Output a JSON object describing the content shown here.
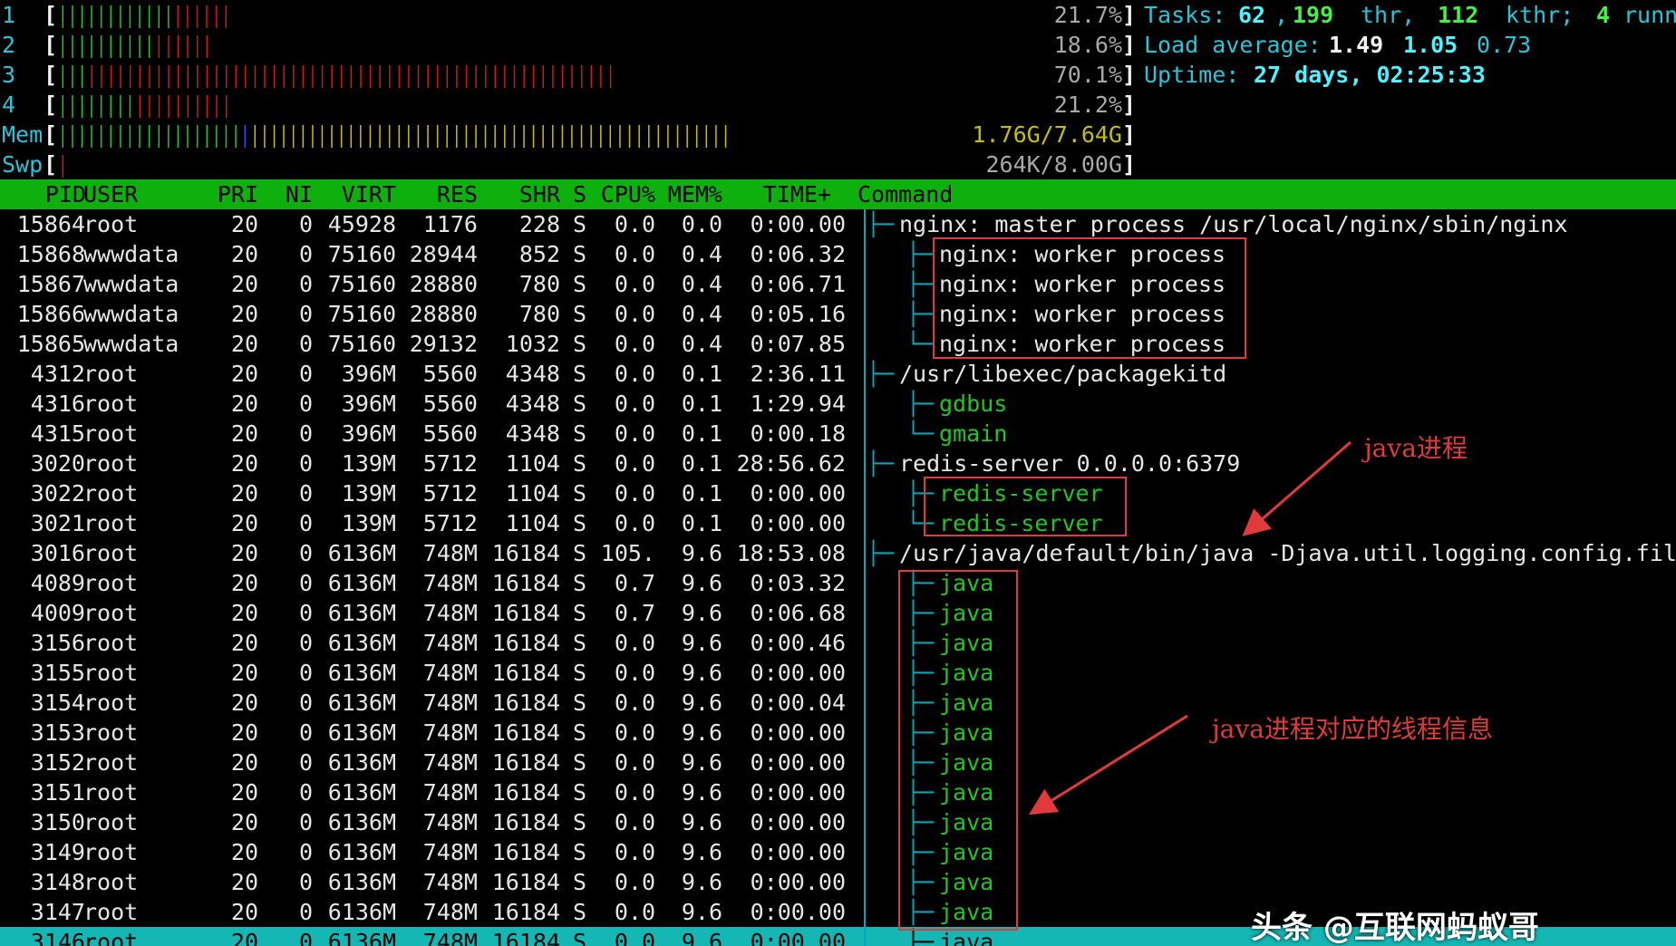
{
  "meters": {
    "cpus": [
      {
        "label": "1",
        "green_bars": 12,
        "red_bars": 6,
        "percent": "21.7%"
      },
      {
        "label": "2",
        "green_bars": 10,
        "red_bars": 6,
        "percent": "18.6%"
      },
      {
        "label": "3",
        "green_bars": 3,
        "red_bars": 55,
        "percent": "70.1%"
      },
      {
        "label": "4",
        "green_bars": 8,
        "red_bars": 10,
        "percent": "21.2%"
      }
    ],
    "mem": {
      "label": "Mem",
      "green_bars": 19,
      "blue_bars": 1,
      "yellow_bars": 50,
      "value": "1.76G/7.64G"
    },
    "swp": {
      "label": "Swp",
      "red_bars": 1,
      "value": "264K/8.00G"
    },
    "open_bracket": "[",
    "close_bracket": "]"
  },
  "summary": {
    "tasks_label": "Tasks:",
    "tasks": "62",
    "thr": "199",
    "thr_label": "thr,",
    "kthr": "112",
    "kthr_label": "kthr;",
    "running": "4",
    "running_label": "running",
    "comma": ",",
    "load_label": "Load average:",
    "load1": "1.49",
    "load5": "1.05",
    "load15": "0.73",
    "uptime_label": "Uptime:",
    "uptime": "27 days, 02:25:33"
  },
  "columns": [
    "PID",
    "USER",
    "PRI",
    "NI",
    "VIRT",
    "RES",
    "SHR",
    "S",
    "CPU%",
    "MEM%",
    "TIME+",
    "Command"
  ],
  "processes": [
    {
      "pid": "15864",
      "user": "root",
      "pri": "20",
      "ni": "0",
      "virt": "45928",
      "res": "1176",
      "shr": "228",
      "s": "S",
      "cpu": "0.0",
      "mem": "0.0",
      "time": "0:00.00",
      "tree": "├─",
      "indent": 0,
      "cmd": "nginx: master process /usr/local/nginx/sbin/nginx",
      "thread": false
    },
    {
      "pid": "15868",
      "user": "wwwdata",
      "pri": "20",
      "ni": "0",
      "virt": "75160",
      "res": "28944",
      "shr": "852",
      "s": "S",
      "cpu": "0.0",
      "mem": "0.4",
      "time": "0:06.32",
      "tree": "├─",
      "indent": 1,
      "cmd": "nginx: worker process",
      "thread": false
    },
    {
      "pid": "15867",
      "user": "wwwdata",
      "pri": "20",
      "ni": "0",
      "virt": "75160",
      "res": "28880",
      "shr": "780",
      "s": "S",
      "cpu": "0.0",
      "mem": "0.4",
      "time": "0:06.71",
      "tree": "├─",
      "indent": 1,
      "cmd": "nginx: worker process",
      "thread": false
    },
    {
      "pid": "15866",
      "user": "wwwdata",
      "pri": "20",
      "ni": "0",
      "virt": "75160",
      "res": "28880",
      "shr": "780",
      "s": "S",
      "cpu": "0.0",
      "mem": "0.4",
      "time": "0:05.16",
      "tree": "├─",
      "indent": 1,
      "cmd": "nginx: worker process",
      "thread": false
    },
    {
      "pid": "15865",
      "user": "wwwdata",
      "pri": "20",
      "ni": "0",
      "virt": "75160",
      "res": "29132",
      "shr": "1032",
      "s": "S",
      "cpu": "0.0",
      "mem": "0.4",
      "time": "0:07.85",
      "tree": "└─",
      "indent": 1,
      "cmd": "nginx: worker process",
      "thread": false
    },
    {
      "pid": "4312",
      "user": "root",
      "pri": "20",
      "ni": "0",
      "virt": "396M",
      "res": "5560",
      "shr": "4348",
      "s": "S",
      "cpu": "0.0",
      "mem": "0.1",
      "time": "2:36.11",
      "tree": "├─",
      "indent": 0,
      "cmd": "/usr/libexec/packagekitd",
      "thread": false
    },
    {
      "pid": "4316",
      "user": "root",
      "pri": "20",
      "ni": "0",
      "virt": "396M",
      "res": "5560",
      "shr": "4348",
      "s": "S",
      "cpu": "0.0",
      "mem": "0.1",
      "time": "1:29.94",
      "tree": "├─",
      "indent": 1,
      "cmd": "gdbus",
      "thread": true
    },
    {
      "pid": "4315",
      "user": "root",
      "pri": "20",
      "ni": "0",
      "virt": "396M",
      "res": "5560",
      "shr": "4348",
      "s": "S",
      "cpu": "0.0",
      "mem": "0.1",
      "time": "0:00.18",
      "tree": "└─",
      "indent": 1,
      "cmd": "gmain",
      "thread": true
    },
    {
      "pid": "3020",
      "user": "root",
      "pri": "20",
      "ni": "0",
      "virt": "139M",
      "res": "5712",
      "shr": "1104",
      "s": "S",
      "cpu": "0.0",
      "mem": "0.1",
      "time": "28:56.62",
      "tree": "├─",
      "indent": 0,
      "cmd": "redis-server 0.0.0.0:6379",
      "thread": false
    },
    {
      "pid": "3022",
      "user": "root",
      "pri": "20",
      "ni": "0",
      "virt": "139M",
      "res": "5712",
      "shr": "1104",
      "s": "S",
      "cpu": "0.0",
      "mem": "0.1",
      "time": "0:00.00",
      "tree": "├─",
      "indent": 1,
      "cmd": "redis-server",
      "thread": true
    },
    {
      "pid": "3021",
      "user": "root",
      "pri": "20",
      "ni": "0",
      "virt": "139M",
      "res": "5712",
      "shr": "1104",
      "s": "S",
      "cpu": "0.0",
      "mem": "0.1",
      "time": "0:00.00",
      "tree": "└─",
      "indent": 1,
      "cmd": "redis-server",
      "thread": true
    },
    {
      "pid": "3016",
      "user": "root",
      "pri": "20",
      "ni": "0",
      "virt": "6136M",
      "res": "748M",
      "shr": "16184",
      "s": "S",
      "cpu": "105.",
      "mem": "9.6",
      "time": "18:53.08",
      "tree": "├─",
      "indent": 0,
      "cmd": "/usr/java/default/bin/java -Djava.util.logging.config.fil",
      "thread": false
    },
    {
      "pid": "4089",
      "user": "root",
      "pri": "20",
      "ni": "0",
      "virt": "6136M",
      "res": "748M",
      "shr": "16184",
      "s": "S",
      "cpu": "0.7",
      "mem": "9.6",
      "time": "0:03.32",
      "tree": "├─",
      "indent": 1,
      "cmd": "java",
      "thread": true
    },
    {
      "pid": "4009",
      "user": "root",
      "pri": "20",
      "ni": "0",
      "virt": "6136M",
      "res": "748M",
      "shr": "16184",
      "s": "S",
      "cpu": "0.7",
      "mem": "9.6",
      "time": "0:06.68",
      "tree": "├─",
      "indent": 1,
      "cmd": "java",
      "thread": true
    },
    {
      "pid": "3156",
      "user": "root",
      "pri": "20",
      "ni": "0",
      "virt": "6136M",
      "res": "748M",
      "shr": "16184",
      "s": "S",
      "cpu": "0.0",
      "mem": "9.6",
      "time": "0:00.46",
      "tree": "├─",
      "indent": 1,
      "cmd": "java",
      "thread": true
    },
    {
      "pid": "3155",
      "user": "root",
      "pri": "20",
      "ni": "0",
      "virt": "6136M",
      "res": "748M",
      "shr": "16184",
      "s": "S",
      "cpu": "0.0",
      "mem": "9.6",
      "time": "0:00.00",
      "tree": "├─",
      "indent": 1,
      "cmd": "java",
      "thread": true
    },
    {
      "pid": "3154",
      "user": "root",
      "pri": "20",
      "ni": "0",
      "virt": "6136M",
      "res": "748M",
      "shr": "16184",
      "s": "S",
      "cpu": "0.0",
      "mem": "9.6",
      "time": "0:00.04",
      "tree": "├─",
      "indent": 1,
      "cmd": "java",
      "thread": true
    },
    {
      "pid": "3153",
      "user": "root",
      "pri": "20",
      "ni": "0",
      "virt": "6136M",
      "res": "748M",
      "shr": "16184",
      "s": "S",
      "cpu": "0.0",
      "mem": "9.6",
      "time": "0:00.00",
      "tree": "├─",
      "indent": 1,
      "cmd": "java",
      "thread": true
    },
    {
      "pid": "3152",
      "user": "root",
      "pri": "20",
      "ni": "0",
      "virt": "6136M",
      "res": "748M",
      "shr": "16184",
      "s": "S",
      "cpu": "0.0",
      "mem": "9.6",
      "time": "0:00.00",
      "tree": "├─",
      "indent": 1,
      "cmd": "java",
      "thread": true
    },
    {
      "pid": "3151",
      "user": "root",
      "pri": "20",
      "ni": "0",
      "virt": "6136M",
      "res": "748M",
      "shr": "16184",
      "s": "S",
      "cpu": "0.0",
      "mem": "9.6",
      "time": "0:00.00",
      "tree": "├─",
      "indent": 1,
      "cmd": "java",
      "thread": true
    },
    {
      "pid": "3150",
      "user": "root",
      "pri": "20",
      "ni": "0",
      "virt": "6136M",
      "res": "748M",
      "shr": "16184",
      "s": "S",
      "cpu": "0.0",
      "mem": "9.6",
      "time": "0:00.00",
      "tree": "├─",
      "indent": 1,
      "cmd": "java",
      "thread": true
    },
    {
      "pid": "3149",
      "user": "root",
      "pri": "20",
      "ni": "0",
      "virt": "6136M",
      "res": "748M",
      "shr": "16184",
      "s": "S",
      "cpu": "0.0",
      "mem": "9.6",
      "time": "0:00.00",
      "tree": "├─",
      "indent": 1,
      "cmd": "java",
      "thread": true
    },
    {
      "pid": "3148",
      "user": "root",
      "pri": "20",
      "ni": "0",
      "virt": "6136M",
      "res": "748M",
      "shr": "16184",
      "s": "S",
      "cpu": "0.0",
      "mem": "9.6",
      "time": "0:00.00",
      "tree": "├─",
      "indent": 1,
      "cmd": "java",
      "thread": true
    },
    {
      "pid": "3147",
      "user": "root",
      "pri": "20",
      "ni": "0",
      "virt": "6136M",
      "res": "748M",
      "shr": "16184",
      "s": "S",
      "cpu": "0.0",
      "mem": "9.6",
      "time": "0:00.00",
      "tree": "├─",
      "indent": 1,
      "cmd": "java",
      "thread": true
    },
    {
      "pid": "3146",
      "user": "root",
      "pri": "20",
      "ni": "0",
      "virt": "6136M",
      "res": "748M",
      "shr": "16184",
      "s": "S",
      "cpu": "0.0",
      "mem": "9.6",
      "time": "0:00.00",
      "tree": "├─",
      "indent": 1,
      "cmd": "java",
      "thread": true,
      "selected": true
    }
  ],
  "annotations": {
    "java_process": "java进程",
    "java_threads": "java进程对应的线程信息",
    "color": "#e03a3a"
  },
  "watermark": "头条 @互联网蚂蚁哥",
  "colors": {
    "header_bg": "#0db00d",
    "selected_bg": "#15b7b5",
    "tree_line": "#00a9b9",
    "thread_text": "#1ec81e"
  }
}
